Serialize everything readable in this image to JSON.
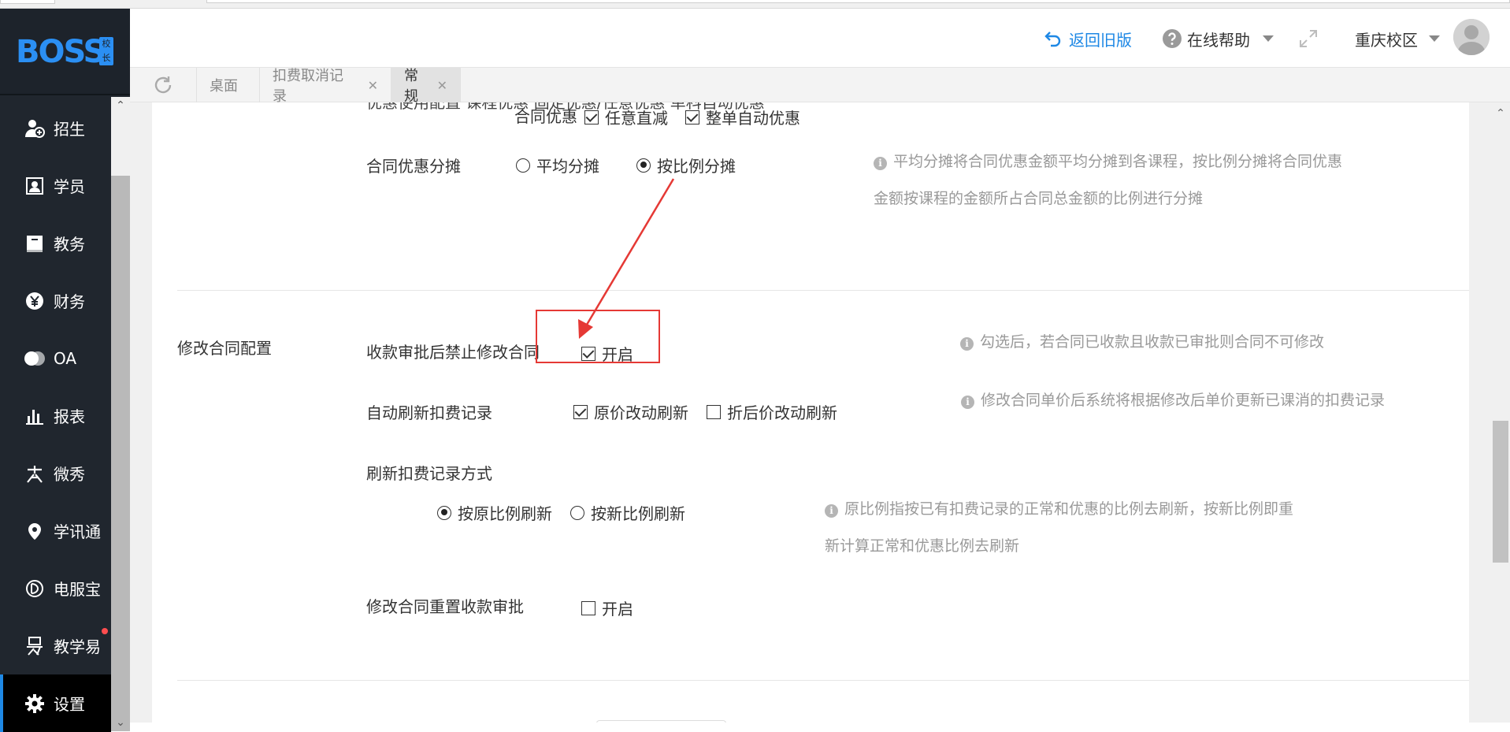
{
  "header": {
    "back_label": "返回旧版",
    "help_label": "在线帮助",
    "campus_label": "重庆校区"
  },
  "logo": {
    "text": "BOSS",
    "badge": "校长"
  },
  "sidebar": {
    "items": [
      {
        "label": "招生",
        "icon": "add-user-icon"
      },
      {
        "label": "学员",
        "icon": "student-card-icon"
      },
      {
        "label": "教务",
        "icon": "book-icon"
      },
      {
        "label": "财务",
        "icon": "yen-coin-icon"
      },
      {
        "label": "OA",
        "icon": "oa-icon"
      },
      {
        "label": "报表",
        "icon": "bar-chart-icon"
      },
      {
        "label": "微秀",
        "icon": "weixiu-icon"
      },
      {
        "label": "学讯通",
        "icon": "location-pin-icon"
      },
      {
        "label": "电服宝",
        "icon": "phone-service-icon"
      },
      {
        "label": "教学易",
        "icon": "jiaoxueyi-icon",
        "has_dot": true
      },
      {
        "label": "设置",
        "icon": "gear-icon",
        "active": true
      }
    ]
  },
  "tabs": [
    {
      "label": "桌面",
      "closable": false
    },
    {
      "label": "扣费取消记录",
      "closable": true
    },
    {
      "label": "常规",
      "closable": true,
      "active": true
    }
  ],
  "content": {
    "partial_top_row": "优惠使用配置    课程优惠    固定优惠/任意优惠    单科自动优惠",
    "contract_discount": {
      "label": "合同优惠",
      "options": [
        "任意直减",
        "整单自动优惠"
      ]
    },
    "discount_share": {
      "label": "合同优惠分摊",
      "options": [
        "平均分摊",
        "按比例分摊"
      ],
      "selected": 1,
      "hint_line1": "平均分摊将合同优惠金额平均分摊到各课程，按比例分摊将合同优惠",
      "hint_line2": "金额按课程的金额所占合同总金额的比例进行分摊"
    },
    "section_title": "修改合同配置",
    "forbid_modify": {
      "label": "收款审批后禁止修改合同",
      "option": "开启",
      "checked": true,
      "hint": "勾选后，若合同已收款且收款已审批则合同不可修改"
    },
    "auto_refresh": {
      "label": "自动刷新扣费记录",
      "options": [
        "原价改动刷新",
        "折后价改动刷新"
      ],
      "checked": [
        true,
        false
      ],
      "hint": "修改合同单价后系统将根据修改后单价更新已课消的扣费记录"
    },
    "refresh_mode": {
      "label": "刷新扣费记录方式",
      "options": [
        "按原比例刷新",
        "按新比例刷新"
      ],
      "selected": 0,
      "hint_line1": "原比例指按已有扣费记录的正常和优惠的比例去刷新，按新比例即重",
      "hint_line2": "新计算正常和优惠比例去刷新"
    },
    "reset_approval": {
      "label": "修改合同重置收款审批",
      "option": "开启",
      "checked": false
    }
  },
  "colors": {
    "sidebar_bg": "#20262e",
    "accent": "#1e88e5",
    "annotation_red": "#e53935"
  }
}
